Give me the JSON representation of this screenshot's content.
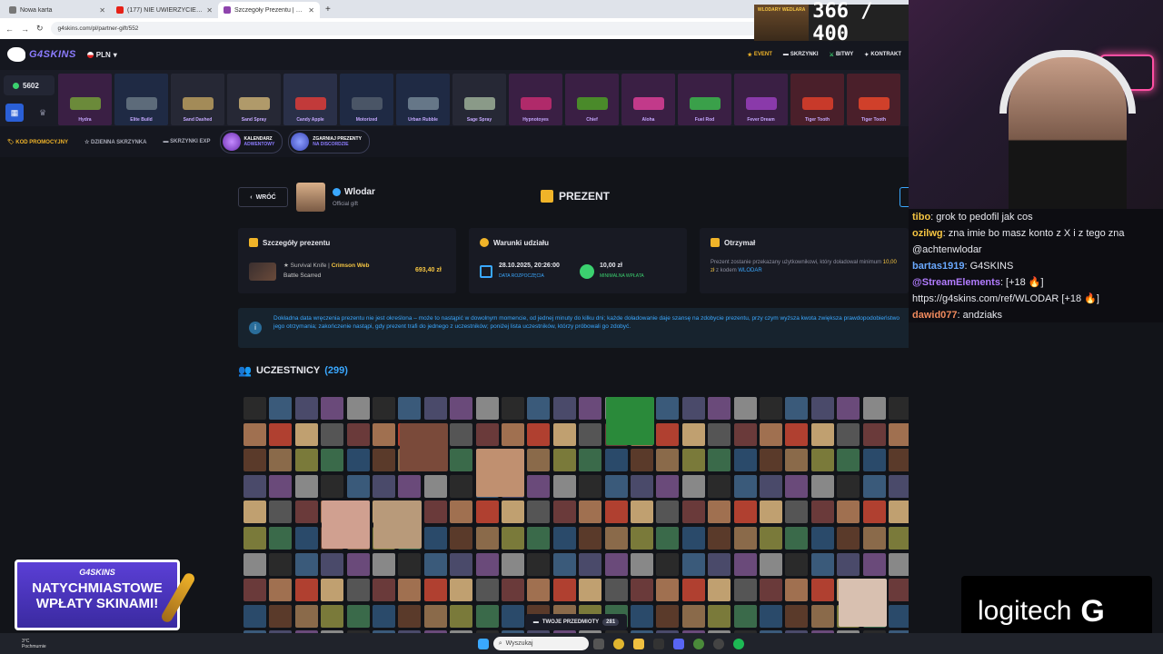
{
  "browser": {
    "tabs": [
      {
        "title": "Nowa karta",
        "color": "#777"
      },
      {
        "title": "(177) NIE UWIERZYCIE ZA ILE T...",
        "color": "#e62117"
      },
      {
        "title": "Szczegóły Prezentu | G4Skins",
        "color": "#8e44ad",
        "active": true
      }
    ],
    "new_tab": "+",
    "url": "g4skins.com/pl/partner-gift/552"
  },
  "header": {
    "logo": "G4SKINS",
    "currency": "PLN",
    "nav": [
      "EVENT",
      "SKRZYNKI",
      "BITWY",
      "KONTRAKT"
    ]
  },
  "strip": {
    "balance": "5602",
    "items": [
      {
        "name": "Hydra",
        "bg": "#3a1f44",
        "gun": "#6b8a3a"
      },
      {
        "name": "Elite Build",
        "bg": "#1f2a44",
        "gun": "#5d6b7a"
      },
      {
        "name": "Sand Dashed",
        "bg": "#262835",
        "gun": "#a38b58"
      },
      {
        "name": "Sand Spray",
        "bg": "#262835",
        "gun": "#b09a6a"
      },
      {
        "name": "Candy Apple",
        "bg": "#2a3048",
        "gun": "#c23a3a"
      },
      {
        "name": "Motorized",
        "bg": "#1f2a44",
        "gun": "#4a5566"
      },
      {
        "name": "Urban Rubble",
        "bg": "#1f2a44",
        "gun": "#667788"
      },
      {
        "name": "Sage Spray",
        "bg": "#262835",
        "gun": "#8a9a88"
      },
      {
        "name": "Hypnotoyes",
        "bg": "#3a1f44",
        "gun": "#b02a6a"
      },
      {
        "name": "Chief",
        "bg": "#3a1f44",
        "gun": "#4a8a2a"
      },
      {
        "name": "Aloha",
        "bg": "#3a1f44",
        "gun": "#c23a8a"
      },
      {
        "name": "Fuel Rod",
        "bg": "#3a1f44",
        "gun": "#3aa04a"
      },
      {
        "name": "Fever Dream",
        "bg": "#3a1f44",
        "gun": "#8a3aaa"
      },
      {
        "name": "Tiger Tooth",
        "bg": "#4a1f2a",
        "gun": "#c83a2a"
      },
      {
        "name": "Tiger Tooth",
        "bg": "#4a1f2a",
        "gun": "#d0402a"
      }
    ]
  },
  "promo": {
    "code_label": "KOD PROMOCYJNY",
    "daily_case": "DZIENNA SKRZYNKA",
    "exp_cases": "SKRZYNKI EXP",
    "calendar_top": "KALENDARZ",
    "calendar_bottom": "ADWENTOWY",
    "discord_top": "ZGARNIAJ PREZENTY",
    "discord_bottom": "NA DISCORDZIE"
  },
  "gift": {
    "back": "WRÓĆ",
    "owner_name": "Wlodar",
    "owner_sub": "Official gift",
    "title": "PREZENT",
    "details_title": "Szczegóły prezentu",
    "item_star": "★ Survival Knife |",
    "item_skin": "Crimson Web",
    "item_quality": "Battle Scarred",
    "item_price": "693,40 zł",
    "conditions_title": "Warunki udziału",
    "start_date": "28.10.2025, 20:26:00",
    "start_label": "DATA ROZPOCZĘCIA",
    "min_amount": "10,00 zł",
    "min_label": "MINIMALNA WPŁATA",
    "receive_title": "Otrzymał",
    "receive_text_1": "Prezent zostanie przekazany użytkownikowi, który",
    "receive_text_2": "doładował minimum",
    "receive_amount": "10,00 zł",
    "receive_text_3": "z kodem",
    "receive_code": "WLODAR",
    "info_text": "Dokładna data wręczenia prezentu nie jest określona – może to nastąpić w dowolnym momencie, od jednej minuty do kilku dni; każde doładowanie daje szansę na zdobycie prezentu, przy czym wyższa kwota zwiększa prawdopodobieństwo jego otrzymania; zakończenie nastąpi, gdy prezent trafi do jednego z uczestników; poniżej lista uczestników, którzy próbowali go zdobyć.",
    "participants_label": "UCZESTNICY",
    "participants_count": "(299)"
  },
  "items_bar": {
    "label": "TWOJE PRZEDMIOTY",
    "count": "281"
  },
  "overlay": {
    "counter": "366 / 400",
    "counter_sign": "WLODARY WEDLARA",
    "chat": [
      {
        "user": "tibo",
        "color": "#f5c542",
        "text": ": grok to pedofil jak cos"
      },
      {
        "user": "ozilwg",
        "color": "#f5c542",
        "text": ": zna imie bo masz konto z X i z tego zna @achtenwlodar"
      },
      {
        "user": "bartas1919",
        "color": "#6aa9ff",
        "text": ": G4SKINS"
      },
      {
        "user": "@StreamElements",
        "color": "#b27cff",
        "text": ": [+18 🔥] https://g4skins.com/ref/WLODAR [+18 🔥]"
      },
      {
        "user": "dawid077",
        "color": "#f08a5d",
        "text": ": andziaks"
      }
    ],
    "banner_brand": "G4SKINS",
    "banner_line1": "NATYCHMIASTOWE",
    "banner_line2": "WPŁATY SKINAMI!",
    "logitech": "logitech"
  },
  "taskbar": {
    "weather_temp": "3°C",
    "weather_desc": "Pochmurnie",
    "search": "Wyszukaj"
  },
  "colors": {
    "accent": "#f0b429",
    "link": "#3aa8ff",
    "price": "#f5c542"
  }
}
